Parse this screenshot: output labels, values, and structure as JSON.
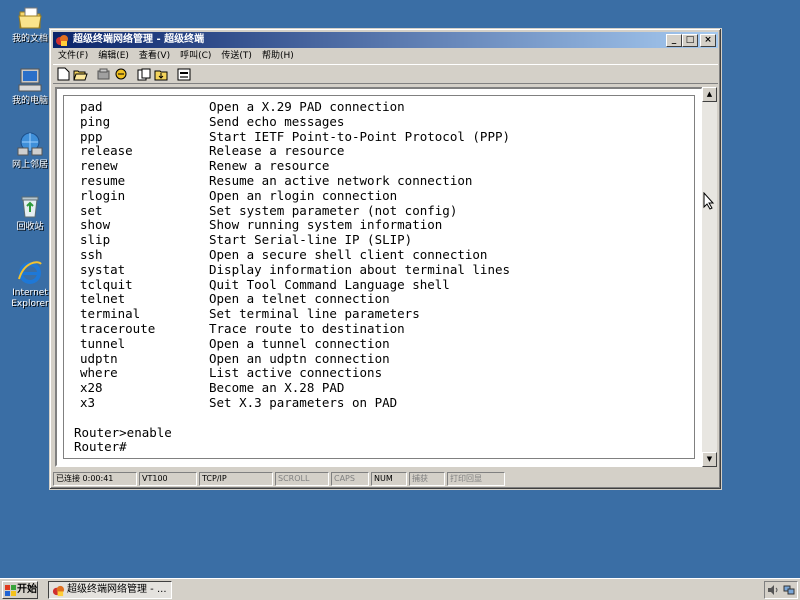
{
  "desktop": {
    "icons": [
      {
        "label": "我的文档",
        "icon": "my-documents-icon"
      },
      {
        "label": "我的电脑",
        "icon": "my-computer-icon"
      },
      {
        "label": "网上邻居",
        "icon": "network-places-icon"
      },
      {
        "label": "回收站",
        "icon": "recycle-bin-icon"
      },
      {
        "label_line1": "Internet",
        "label_line2": "Explorer",
        "icon": "internet-explorer-icon"
      }
    ]
  },
  "window": {
    "title": "超级终端网络管理 - 超级终端",
    "controls": {
      "minimize": "_",
      "maximize": "□",
      "close": "×"
    },
    "menu": [
      "文件(F)",
      "编辑(E)",
      "查看(V)",
      "呼叫(C)",
      "传送(T)",
      "帮助(H)"
    ],
    "toolbar": [
      "new-icon",
      "open-icon",
      "disconnect-icon",
      "properties-icon",
      "send-icon",
      "receive-icon",
      "copy-icon"
    ]
  },
  "terminal": {
    "commands": [
      {
        "name": "pad",
        "desc": "Open a X.29 PAD connection"
      },
      {
        "name": "ping",
        "desc": "Send echo messages"
      },
      {
        "name": "ppp",
        "desc": "Start IETF Point-to-Point Protocol (PPP)"
      },
      {
        "name": "release",
        "desc": "Release a resource"
      },
      {
        "name": "renew",
        "desc": "Renew a resource"
      },
      {
        "name": "resume",
        "desc": "Resume an active network connection"
      },
      {
        "name": "rlogin",
        "desc": "Open an rlogin connection"
      },
      {
        "name": "set",
        "desc": "Set system parameter (not config)"
      },
      {
        "name": "show",
        "desc": "Show running system information"
      },
      {
        "name": "slip",
        "desc": "Start Serial-line IP (SLIP)"
      },
      {
        "name": "ssh",
        "desc": "Open a secure shell client connection"
      },
      {
        "name": "systat",
        "desc": "Display information about terminal lines"
      },
      {
        "name": "tclquit",
        "desc": "Quit Tool Command Language shell"
      },
      {
        "name": "telnet",
        "desc": "Open a telnet connection"
      },
      {
        "name": "terminal",
        "desc": "Set terminal line parameters"
      },
      {
        "name": "traceroute",
        "desc": "Trace route to destination"
      },
      {
        "name": "tunnel",
        "desc": "Open a tunnel connection"
      },
      {
        "name": "udptn",
        "desc": "Open an udptn connection"
      },
      {
        "name": "where",
        "desc": "List active connections"
      },
      {
        "name": "x28",
        "desc": "Become an X.28 PAD"
      },
      {
        "name": "x3",
        "desc": "Set X.3 parameters on PAD"
      }
    ],
    "prompt_enable": "Router>enable",
    "prompt_current": "Router#"
  },
  "statusbar": {
    "connected": "已连接 0:00:41",
    "emulation": "VT100",
    "protocol": "TCP/IP",
    "scroll": "SCROLL",
    "caps": "CAPS",
    "num": "NUM",
    "capture": "捕获",
    "print_echo": "打印回显"
  },
  "taskbar": {
    "start_label": "开始",
    "task_label": "超级终端网络管理 - ..."
  },
  "colors": {
    "desktop": "#3a6ea5",
    "titlebar_start": "#0a246a",
    "titlebar_end": "#a6caf0",
    "chrome": "#d4d0c8"
  }
}
